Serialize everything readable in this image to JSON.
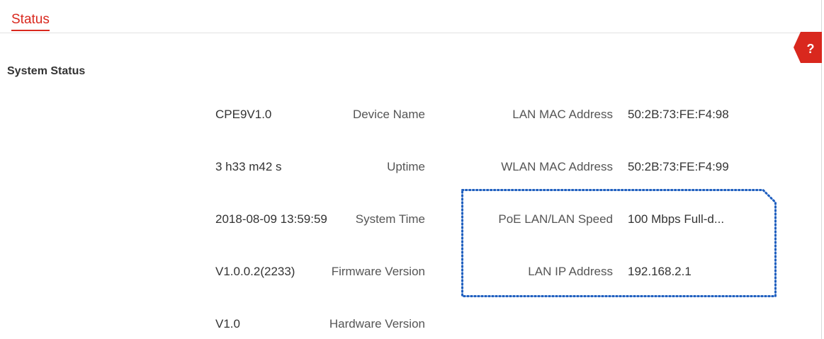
{
  "tab": {
    "label": "Status"
  },
  "help": {
    "glyph": "?",
    "color": "#d9281e"
  },
  "section": {
    "title": "System Status"
  },
  "left_fields": [
    {
      "label": "Device Name",
      "value": "CPE9V1.0"
    },
    {
      "label": "Uptime",
      "value": "3 h33 m42 s"
    },
    {
      "label": "System Time",
      "value": "2018-08-09 13:59:59"
    },
    {
      "label": "Firmware Version",
      "value": "V1.0.0.2(2233)"
    },
    {
      "label": "Hardware Version",
      "value": "V1.0"
    }
  ],
  "right_fields": [
    {
      "label": "LAN MAC Address",
      "value": "50:2B:73:FE:F4:98"
    },
    {
      "label": "WLAN MAC Address",
      "value": "50:2B:73:FE:F4:99"
    },
    {
      "label": "PoE LAN/LAN Speed",
      "value": "100 Mbps Full-d..."
    },
    {
      "label": "LAN IP Address",
      "value": "192.168.2.1"
    }
  ],
  "colors": {
    "accent": "#d9281e",
    "highlight_border": "#1f5fbf"
  }
}
